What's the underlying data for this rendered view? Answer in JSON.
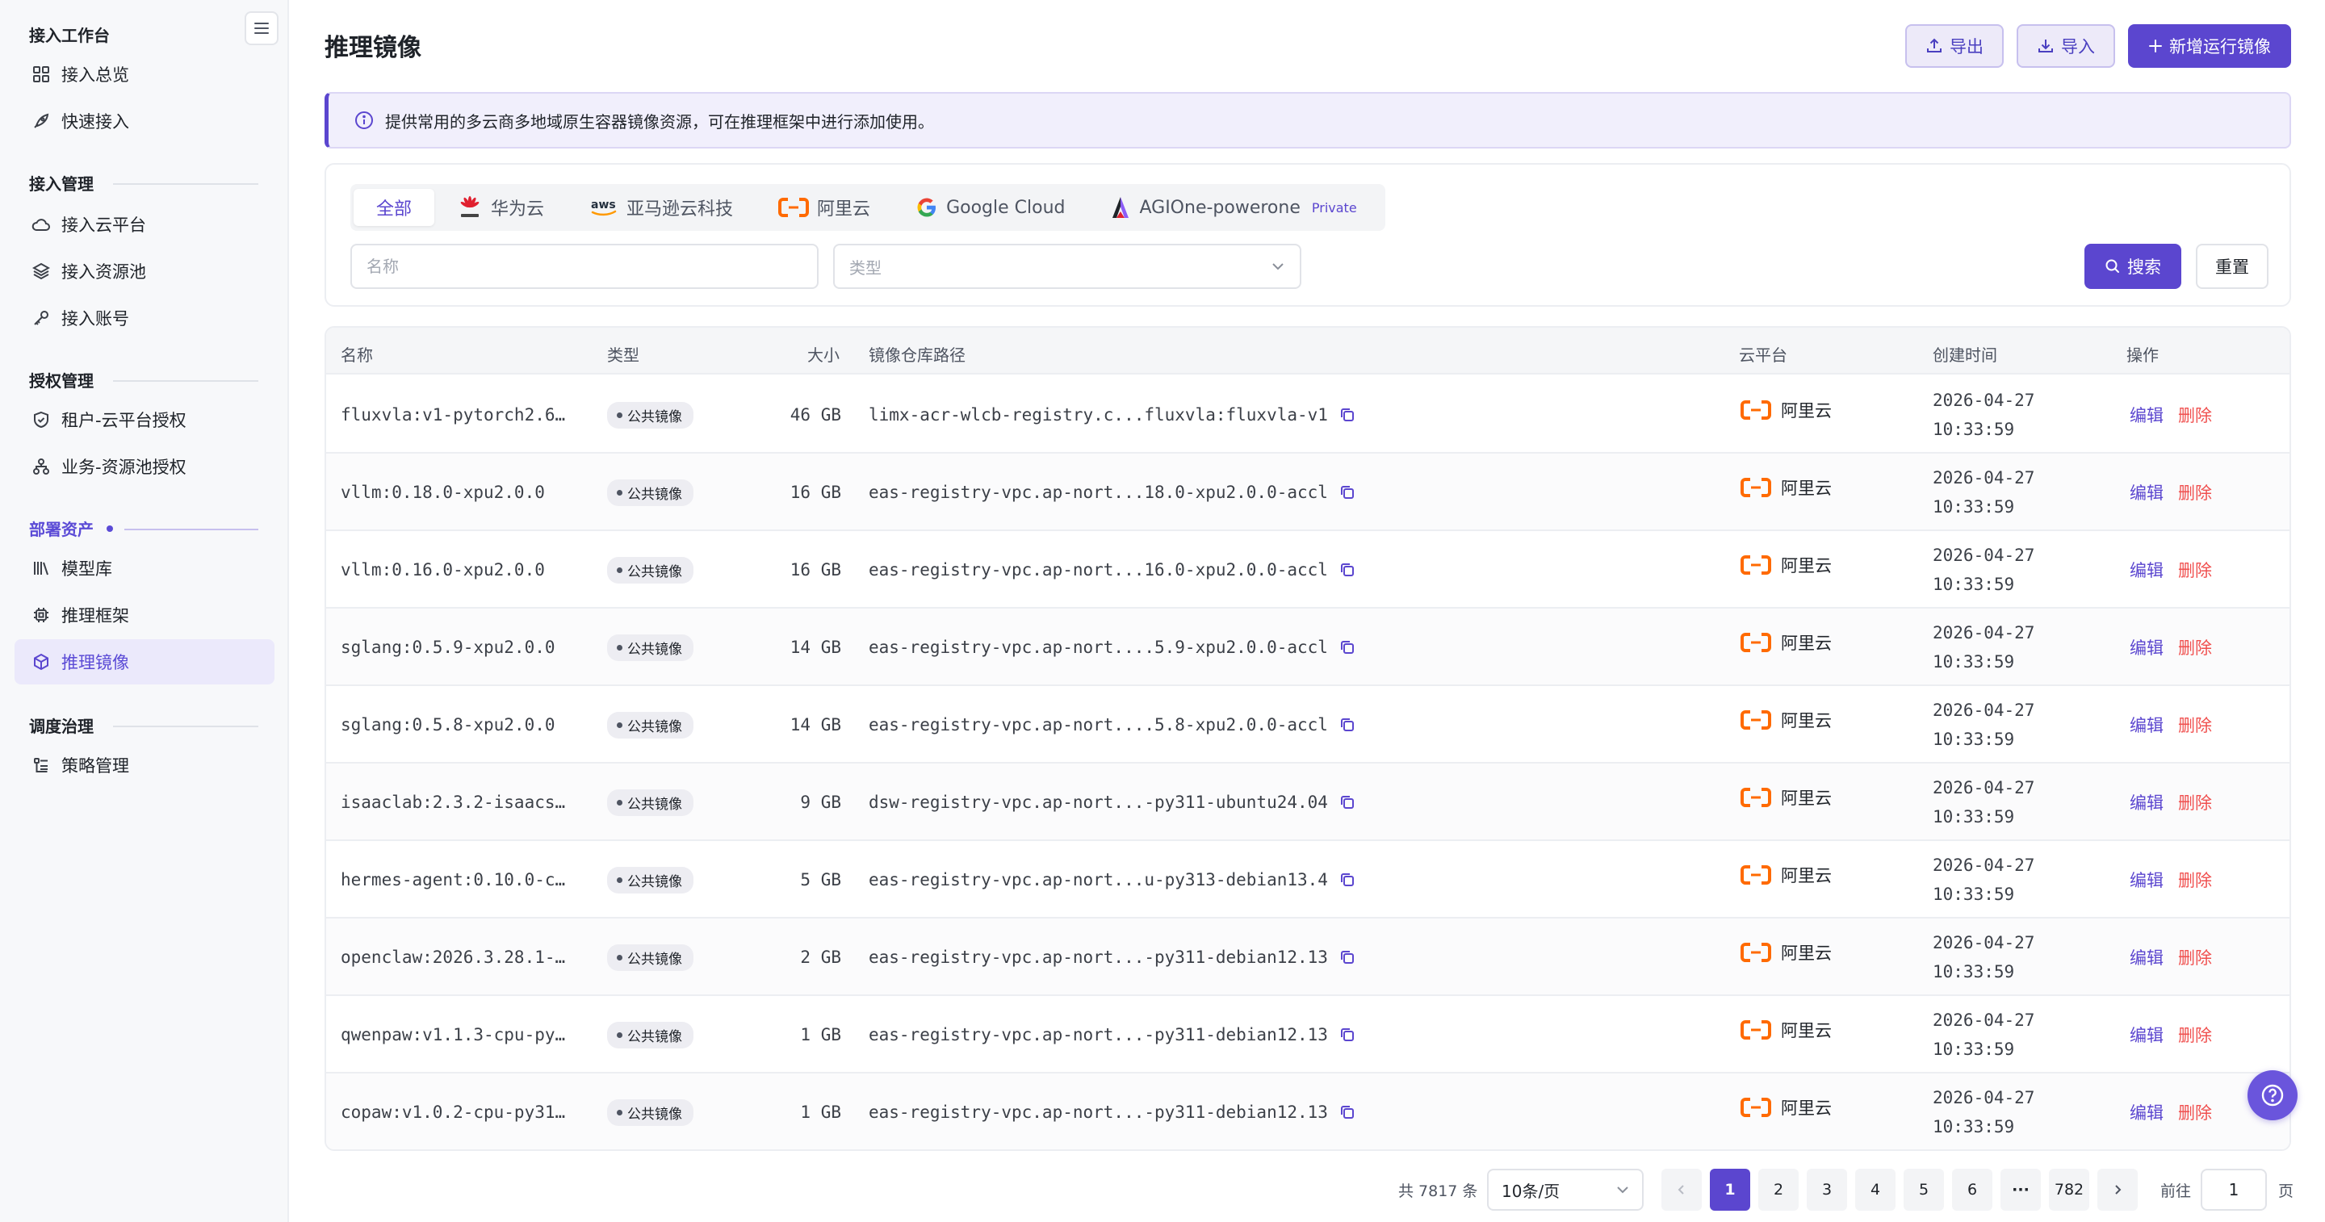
{
  "colors": {
    "accent": "#5b46cf",
    "danger": "#f0504f",
    "aliyun": "#ff6a00",
    "sidebar_bg": "#f7f8fa"
  },
  "sidebar": {
    "sections": [
      {
        "title": "接入工作台",
        "items": [
          {
            "label": "接入总览",
            "icon": "dashboard-grid-icon"
          },
          {
            "label": "快速接入",
            "icon": "rocket-icon"
          }
        ]
      },
      {
        "title": "接入管理",
        "items": [
          {
            "label": "接入云平台",
            "icon": "cloud-icon"
          },
          {
            "label": "接入资源池",
            "icon": "layers-icon"
          },
          {
            "label": "接入账号",
            "icon": "key-icon"
          }
        ]
      },
      {
        "title": "授权管理",
        "items": [
          {
            "label": "租户-云平台授权",
            "icon": "shield-check-icon"
          },
          {
            "label": "业务-资源池授权",
            "icon": "org-tree-icon"
          }
        ]
      },
      {
        "title": "部署资产",
        "items": [
          {
            "label": "模型库",
            "icon": "library-icon"
          },
          {
            "label": "推理框架",
            "icon": "chip-icon"
          },
          {
            "label": "推理镜像",
            "icon": "cube-icon"
          }
        ]
      },
      {
        "title": "调度治理",
        "items": [
          {
            "label": "策略管理",
            "icon": "policy-list-icon"
          }
        ]
      }
    ]
  },
  "header": {
    "title": "推理镜像",
    "export_label": "导出",
    "import_label": "导入",
    "create_label": "新增运行镜像"
  },
  "notice": {
    "text": "提供常用的多云商多地域原生容器镜像资源，可在推理框架中进行添加使用。"
  },
  "filters": {
    "tabs": [
      {
        "label": "全部"
      },
      {
        "label": "华为云",
        "icon": "huawei-logo-icon"
      },
      {
        "label": "亚马逊云科技",
        "icon": "aws-logo-icon"
      },
      {
        "label": "阿里云",
        "icon": "aliyun-logo-icon"
      },
      {
        "label": "Google Cloud",
        "icon": "google-logo-icon"
      },
      {
        "label": "AGIOne-powerone",
        "icon": "agione-logo-icon",
        "tag": "Private"
      }
    ],
    "name_placeholder": "名称",
    "type_placeholder": "类型",
    "search_label": "搜索",
    "reset_label": "重置"
  },
  "table": {
    "columns": {
      "name": "名称",
      "type": "类型",
      "size": "大小",
      "path": "镜像仓库路径",
      "cloud": "云平台",
      "created": "创建时间",
      "actions": "操作"
    },
    "edit_label": "编辑",
    "delete_label": "删除",
    "rows": [
      {
        "name": "fluxvla:v1-pytorch2.6…",
        "type": "公共镜像",
        "size": "46 GB",
        "path": "limx-acr-wlcb-registry.c...fluxvla:fluxvla-v1",
        "cloud": "阿里云",
        "date": "2026-04-27",
        "time": "10:33:59"
      },
      {
        "name": "vllm:0.18.0-xpu2.0.0",
        "type": "公共镜像",
        "size": "16 GB",
        "path": "eas-registry-vpc.ap-nort...18.0-xpu2.0.0-accl",
        "cloud": "阿里云",
        "date": "2026-04-27",
        "time": "10:33:59"
      },
      {
        "name": "vllm:0.16.0-xpu2.0.0",
        "type": "公共镜像",
        "size": "16 GB",
        "path": "eas-registry-vpc.ap-nort...16.0-xpu2.0.0-accl",
        "cloud": "阿里云",
        "date": "2026-04-27",
        "time": "10:33:59"
      },
      {
        "name": "sglang:0.5.9-xpu2.0.0",
        "type": "公共镜像",
        "size": "14 GB",
        "path": "eas-registry-vpc.ap-nort....5.9-xpu2.0.0-accl",
        "cloud": "阿里云",
        "date": "2026-04-27",
        "time": "10:33:59"
      },
      {
        "name": "sglang:0.5.8-xpu2.0.0",
        "type": "公共镜像",
        "size": "14 GB",
        "path": "eas-registry-vpc.ap-nort....5.8-xpu2.0.0-accl",
        "cloud": "阿里云",
        "date": "2026-04-27",
        "time": "10:33:59"
      },
      {
        "name": "isaaclab:2.3.2-isaacs…",
        "type": "公共镜像",
        "size": "9 GB",
        "path": "dsw-registry-vpc.ap-nort...-py311-ubuntu24.04",
        "cloud": "阿里云",
        "date": "2026-04-27",
        "time": "10:33:59"
      },
      {
        "name": "hermes-agent:0.10.0-c…",
        "type": "公共镜像",
        "size": "5 GB",
        "path": "eas-registry-vpc.ap-nort...u-py313-debian13.4",
        "cloud": "阿里云",
        "date": "2026-04-27",
        "time": "10:33:59"
      },
      {
        "name": "openclaw:2026.3.28.1-…",
        "type": "公共镜像",
        "size": "2 GB",
        "path": "eas-registry-vpc.ap-nort...-py311-debian12.13",
        "cloud": "阿里云",
        "date": "2026-04-27",
        "time": "10:33:59"
      },
      {
        "name": "qwenpaw:v1.1.3-cpu-py…",
        "type": "公共镜像",
        "size": "1 GB",
        "path": "eas-registry-vpc.ap-nort...-py311-debian12.13",
        "cloud": "阿里云",
        "date": "2026-04-27",
        "time": "10:33:59"
      },
      {
        "name": "copaw:v1.0.2-cpu-py31…",
        "type": "公共镜像",
        "size": "1 GB",
        "path": "eas-registry-vpc.ap-nort...-py311-debian12.13",
        "cloud": "阿里云",
        "date": "2026-04-27",
        "time": "10:33:59"
      }
    ]
  },
  "pagination": {
    "total_text": "共 7817 条",
    "page_size": "10条/页",
    "pages": [
      "1",
      "2",
      "3",
      "4",
      "5",
      "6",
      "···",
      "782"
    ],
    "current": "1",
    "goto_label": "前往",
    "goto_value": "1",
    "goto_suffix": "页"
  }
}
